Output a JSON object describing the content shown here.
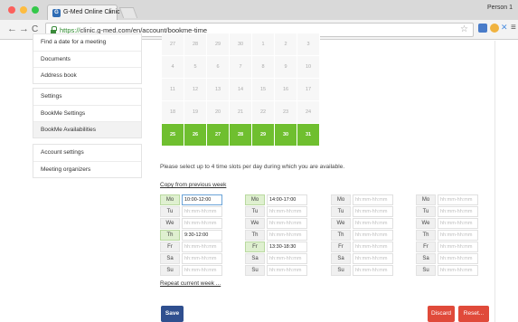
{
  "browser": {
    "tab_title": "G-Med Online Clinic",
    "tab_close": "×",
    "favicon_text": "G",
    "profile": "Person 1",
    "url_scheme": "https://",
    "url_rest": "clinic.g-med.com/en/account/bookme-time",
    "nav": {
      "back": "←",
      "forward": "→",
      "reload": "C"
    }
  },
  "sidebar": {
    "group1": [
      "Find a date for a meeting",
      "Documents",
      "Address book"
    ],
    "group2": [
      "Settings",
      "BookMe Settings",
      "BookMe Availabilities"
    ],
    "group3": [
      "Account settings",
      "Meeting organizers"
    ],
    "active_item": "BookMe Availabilities"
  },
  "calendar": {
    "rows": [
      [
        "27",
        "28",
        "29",
        "30",
        "1",
        "2",
        "3"
      ],
      [
        "4",
        "5",
        "6",
        "7",
        "8",
        "9",
        "10"
      ],
      [
        "11",
        "12",
        "13",
        "14",
        "15",
        "16",
        "17"
      ],
      [
        "18",
        "19",
        "20",
        "21",
        "22",
        "23",
        "24"
      ],
      [
        "25",
        "26",
        "27",
        "28",
        "29",
        "30",
        "31"
      ]
    ],
    "selected_row_index": 4,
    "selected_color": "#6fbf2f"
  },
  "instructions": "Please select up to 4 time slots per day during which you are available.",
  "copy_link": "Copy from previous week",
  "placeholder": "hh:mm-hh:mm",
  "weeks": [
    {
      "days": [
        {
          "label": "Mo",
          "value": "10:00-12:00",
          "on": true,
          "focused": true
        },
        {
          "label": "Tu",
          "value": "",
          "on": false
        },
        {
          "label": "We",
          "value": "",
          "on": false
        },
        {
          "label": "Th",
          "value": "9:30-12:00",
          "on": true
        },
        {
          "label": "Fr",
          "value": "",
          "on": false
        },
        {
          "label": "Sa",
          "value": "",
          "on": false
        },
        {
          "label": "Su",
          "value": "",
          "on": false
        }
      ]
    },
    {
      "days": [
        {
          "label": "Mo",
          "value": "14:00-17:00",
          "on": true
        },
        {
          "label": "Tu",
          "value": "",
          "on": false
        },
        {
          "label": "We",
          "value": "",
          "on": false
        },
        {
          "label": "Th",
          "value": "",
          "on": false
        },
        {
          "label": "Fr",
          "value": "13:30-18:30",
          "on": true
        },
        {
          "label": "Sa",
          "value": "",
          "on": false
        },
        {
          "label": "Su",
          "value": "",
          "on": false
        }
      ]
    },
    {
      "days": [
        {
          "label": "Mo",
          "value": "",
          "on": false
        },
        {
          "label": "Tu",
          "value": "",
          "on": false
        },
        {
          "label": "We",
          "value": "",
          "on": false
        },
        {
          "label": "Th",
          "value": "",
          "on": false
        },
        {
          "label": "Fr",
          "value": "",
          "on": false
        },
        {
          "label": "Sa",
          "value": "",
          "on": false
        },
        {
          "label": "Su",
          "value": "",
          "on": false
        }
      ]
    },
    {
      "days": [
        {
          "label": "Mo",
          "value": "",
          "on": false
        },
        {
          "label": "Tu",
          "value": "",
          "on": false
        },
        {
          "label": "We",
          "value": "",
          "on": false
        },
        {
          "label": "Th",
          "value": "",
          "on": false
        },
        {
          "label": "Fr",
          "value": "",
          "on": false
        },
        {
          "label": "Sa",
          "value": "",
          "on": false
        },
        {
          "label": "Su",
          "value": "",
          "on": false
        }
      ]
    }
  ],
  "repeat_link": "Repeat current week ...",
  "buttons": {
    "save": "Save",
    "discard": "Discard",
    "reset": "Reset..."
  },
  "colors": {
    "primary": "#2f4f8f",
    "danger": "#e04a3a",
    "accent_green": "#6fbf2f"
  }
}
